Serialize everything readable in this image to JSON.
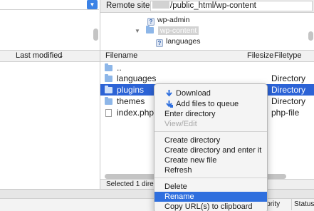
{
  "left": {
    "columns": {
      "last_modified": "Last modified",
      "sort_indicator": "chevron-down-icon"
    }
  },
  "remote": {
    "label": "Remote site:",
    "path": "/public_html/wp-content",
    "tree": [
      {
        "name": "wp-admin",
        "icon": "unknown-folder-icon"
      },
      {
        "name": "wp-content",
        "icon": "folder-icon",
        "expanded": true,
        "selected": true
      },
      {
        "name": "languages",
        "icon": "unknown-folder-icon"
      }
    ],
    "columns": {
      "filename": "Filename",
      "filesize": "Filesize",
      "filetype": "Filetype"
    },
    "files": [
      {
        "name": "..",
        "type": "",
        "icon": "folder-icon"
      },
      {
        "name": "languages",
        "type": "Directory",
        "icon": "folder-icon"
      },
      {
        "name": "plugins",
        "type": "Directory",
        "icon": "folder-icon",
        "selected": true
      },
      {
        "name": "themes",
        "type": "Directory",
        "icon": "folder-icon"
      },
      {
        "name": "index.php",
        "type": "php-file",
        "icon": "file-icon"
      }
    ],
    "status": "Selected 1 direct"
  },
  "queue": {
    "columns": {
      "priority": "iority",
      "status": "Status"
    }
  },
  "context_menu": {
    "items": [
      {
        "label": "Download",
        "icon": "download-arrow-icon"
      },
      {
        "label": "Add files to queue",
        "icon": "add-to-queue-icon"
      },
      {
        "label": "Enter directory"
      },
      {
        "label": "View/Edit",
        "disabled": true
      },
      {
        "label": "Create directory"
      },
      {
        "label": "Create directory and enter it"
      },
      {
        "label": "Create new file"
      },
      {
        "label": "Refresh"
      },
      {
        "label": "Delete"
      },
      {
        "label": "Rename",
        "highlighted": true
      },
      {
        "label": "Copy URL(s) to clipboard"
      }
    ]
  },
  "colors": {
    "selection": "#2c63d6",
    "menu_highlight": "#2f6fde",
    "accent_button": "#3b82e6"
  }
}
